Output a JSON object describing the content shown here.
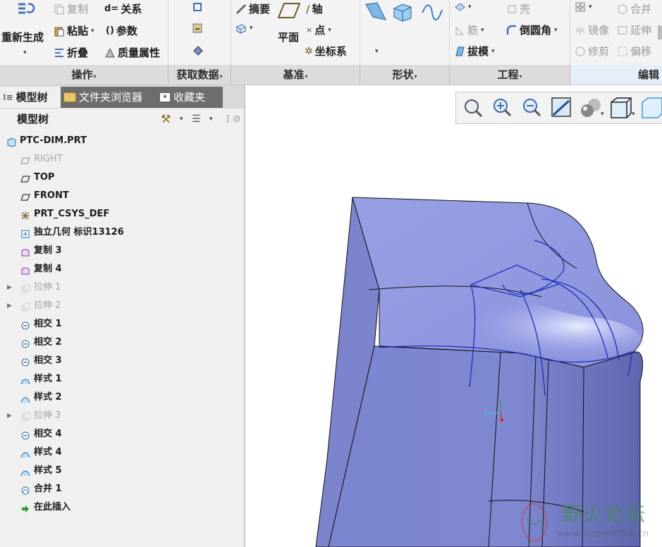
{
  "ribbon": {
    "ops": {
      "regen": "重新生成",
      "copy": "复制",
      "relations": "关系",
      "paste": "粘贴",
      "params": "参数",
      "fold": "折叠",
      "mass": "质量属性"
    },
    "datum": {
      "summary": "摘要",
      "plane": "平面",
      "axis": "轴",
      "point": "点",
      "csys": "坐标系"
    },
    "eng": {
      "shell": "壳",
      "rib": "筋",
      "round": "倒圆角",
      "draft": "拔模"
    },
    "edit": {
      "merge": "合并",
      "mirror": "镜像",
      "extend": "延伸",
      "trim": "修剪",
      "offset": "偏移"
    }
  },
  "groups": {
    "ops": "操作",
    "getdata": "获取数据",
    "datum": "基准",
    "shape": "形状",
    "engineering": "工程",
    "edit": "编辑"
  },
  "tabs": {
    "model_tree": "模型树",
    "folder_browser": "文件夹浏览器",
    "favorites": "收藏夹"
  },
  "tree_header": "模型树",
  "tree": [
    {
      "label": "PTC-DIM.PRT",
      "icon": "part-icon",
      "dim": false,
      "exp": false
    },
    {
      "label": "RIGHT",
      "icon": "datum-plane-icon",
      "dim": true,
      "exp": false
    },
    {
      "label": "TOP",
      "icon": "datum-plane-icon",
      "dim": false,
      "exp": false
    },
    {
      "label": "FRONT",
      "icon": "datum-plane-icon",
      "dim": false,
      "exp": false
    },
    {
      "label": "PRT_CSYS_DEF",
      "icon": "csys-icon",
      "dim": false,
      "exp": false
    },
    {
      "label": "独立几何 标识13126",
      "icon": "independent-geometry-icon",
      "dim": false,
      "exp": false
    },
    {
      "label": "复制 3",
      "icon": "copy-surface-icon",
      "dim": false,
      "exp": false
    },
    {
      "label": "复制 4",
      "icon": "copy-surface-icon",
      "dim": false,
      "exp": false
    },
    {
      "label": "拉伸 1",
      "icon": "extrude-icon",
      "dim": true,
      "exp": true
    },
    {
      "label": "拉伸 2",
      "icon": "extrude-icon",
      "dim": true,
      "exp": true
    },
    {
      "label": "相交 1",
      "icon": "intersect-icon",
      "dim": false,
      "exp": false
    },
    {
      "label": "相交 2",
      "icon": "intersect-icon",
      "dim": false,
      "exp": false
    },
    {
      "label": "相交 3",
      "icon": "intersect-icon",
      "dim": false,
      "exp": false
    },
    {
      "label": "样式 1",
      "icon": "style-icon",
      "dim": false,
      "exp": false
    },
    {
      "label": "样式 2",
      "icon": "style-icon",
      "dim": false,
      "exp": false
    },
    {
      "label": "拉伸 3",
      "icon": "extrude-icon",
      "dim": true,
      "exp": true
    },
    {
      "label": "相交 4",
      "icon": "intersect-icon",
      "dim": false,
      "exp": false
    },
    {
      "label": "样式 4",
      "icon": "style-icon",
      "dim": false,
      "exp": false
    },
    {
      "label": "样式 5",
      "icon": "style-icon",
      "dim": false,
      "exp": false
    },
    {
      "label": "合并 1",
      "icon": "merge-icon",
      "dim": false,
      "exp": false
    },
    {
      "label": "在此插入",
      "icon": "insert-here-icon",
      "dim": false,
      "exp": false
    }
  ],
  "watermark": {
    "title": "野火论坛",
    "url": "www.proewildfire.cn"
  },
  "colors": {
    "model": "#8f97de",
    "model_dark": "#6d76c4",
    "curve": "#1f2fb8"
  }
}
